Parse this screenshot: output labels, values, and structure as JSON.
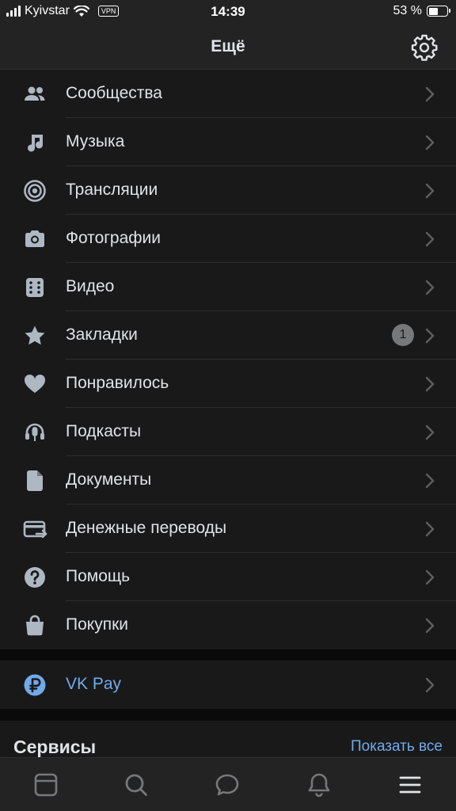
{
  "status_bar": {
    "carrier": "Kyivstar",
    "vpn": "VPN",
    "time": "14:39",
    "battery": "53 %",
    "battery_level": 0.53
  },
  "header": {
    "title": "Ещё"
  },
  "menu": {
    "items": [
      {
        "label": "Сообщества",
        "icon": "users-icon"
      },
      {
        "label": "Музыка",
        "icon": "music-note-icon"
      },
      {
        "label": "Трансляции",
        "icon": "broadcast-icon"
      },
      {
        "label": "Фотографии",
        "icon": "camera-icon"
      },
      {
        "label": "Видео",
        "icon": "video-icon"
      },
      {
        "label": "Закладки",
        "icon": "star-icon",
        "badge": "1"
      },
      {
        "label": "Понравилось",
        "icon": "heart-icon"
      },
      {
        "label": "Подкасты",
        "icon": "podcast-icon"
      },
      {
        "label": "Документы",
        "icon": "document-icon"
      },
      {
        "label": "Денежные переводы",
        "icon": "money-transfer-icon"
      },
      {
        "label": "Помощь",
        "icon": "help-icon"
      },
      {
        "label": "Покупки",
        "icon": "shopping-bag-icon"
      }
    ]
  },
  "vk_pay": {
    "label": "VK Pay",
    "icon": "ruble-icon"
  },
  "services": {
    "title": "Сервисы",
    "show_all": "Показать все"
  },
  "tab_bar": {
    "tabs": [
      {
        "icon": "news-icon"
      },
      {
        "icon": "search-icon"
      },
      {
        "icon": "messages-icon"
      },
      {
        "icon": "notifications-icon"
      },
      {
        "icon": "menu-icon",
        "active": true
      }
    ]
  },
  "colors": {
    "background": "#0a0a0a",
    "panel": "#19191a",
    "bar": "#232324",
    "text": "#e1e3e6",
    "icon": "#aeb7c2",
    "accent": "#71aaeb"
  }
}
